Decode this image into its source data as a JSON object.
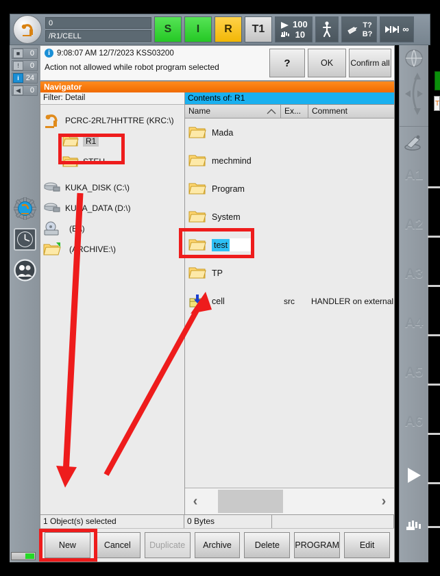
{
  "status_bar": {
    "program_number": "0",
    "program_path": "/R1/CELL",
    "submit_state": "S",
    "drives_state": "I",
    "robot_state": "R",
    "mode": "T1",
    "program_override": "100",
    "jog_override": "10",
    "increment_label": "∞",
    "tool_label": "T?",
    "base_label": "B?"
  },
  "message_counters": [
    {
      "icon": "ack-message-icon",
      "count": "0"
    },
    {
      "icon": "warning-message-icon",
      "count": "0"
    },
    {
      "icon": "info-message-icon",
      "count": "24"
    },
    {
      "icon": "wait-message-icon",
      "count": "0"
    }
  ],
  "message": {
    "timestamp": "9:08:07 AM 12/7/2023 KSS03200",
    "text": "Action not allowed while robot program selected",
    "help_label": "?",
    "ok_label": "OK",
    "confirm_all_label": "Confirm all"
  },
  "navigator": {
    "title": "Navigator",
    "filter_label": "Filter: Detail",
    "tree": [
      {
        "name": "PCRC-2RL7HHTTRE (KRC:\\)",
        "icon": "robot-icon",
        "level": 0,
        "selected": false
      },
      {
        "name": "R1",
        "icon": "folder-icon",
        "level": 1,
        "selected": true
      },
      {
        "name": "STEU",
        "icon": "folder-icon",
        "level": 1,
        "selected": false
      },
      {
        "name": "KUKA_DISK (C:\\)",
        "icon": "harddisk-icon",
        "level": 0,
        "selected": false
      },
      {
        "name": "KUKA_DATA (D:\\)",
        "icon": "harddisk-icon",
        "level": 0,
        "selected": false
      },
      {
        "name": "(E:\\)",
        "icon": "cddrive-icon",
        "level": 0,
        "selected": false
      },
      {
        "name": "(ARCHIVE:\\)",
        "icon": "archive-folder-icon",
        "level": 0,
        "selected": false
      }
    ],
    "contents_title": "Contents of: R1",
    "columns": [
      "Name",
      "Ex...",
      "Comment"
    ],
    "rows": [
      {
        "name": "Mada",
        "icon": "folder-icon",
        "ext": "",
        "comment": "",
        "editing": false
      },
      {
        "name": "mechmind",
        "icon": "folder-icon",
        "ext": "",
        "comment": "",
        "editing": false
      },
      {
        "name": "Program",
        "icon": "folder-icon",
        "ext": "",
        "comment": "",
        "editing": false
      },
      {
        "name": "System",
        "icon": "folder-icon",
        "ext": "",
        "comment": "",
        "editing": false
      },
      {
        "name": "test",
        "icon": "folder-icon",
        "ext": "",
        "comment": "",
        "editing": true
      },
      {
        "name": "TP",
        "icon": "folder-icon",
        "ext": "",
        "comment": "",
        "editing": false
      },
      {
        "name": "cell",
        "icon": "module-icon",
        "ext": "src",
        "comment": "HANDLER on external .",
        "editing": false
      }
    ],
    "scroll_left_label": "‹",
    "scroll_right_label": "›",
    "status_selected": "1 Object(s) selected",
    "status_bytes": "0 Bytes",
    "status_extra": "",
    "buttons": [
      {
        "label": "New",
        "enabled": true,
        "highlighted": true
      },
      {
        "label": "Cancel",
        "enabled": true,
        "highlighted": false
      },
      {
        "label": "Duplicate",
        "enabled": false,
        "highlighted": false
      },
      {
        "label": "Archive",
        "enabled": true,
        "highlighted": false
      },
      {
        "label": "Delete",
        "enabled": true,
        "highlighted": false
      },
      {
        "label": "PROGRAM",
        "enabled": true,
        "highlighted": false
      },
      {
        "label": "Edit",
        "enabled": true,
        "highlighted": false
      }
    ]
  },
  "jog_strip": {
    "axes": [
      "A1",
      "A2",
      "A3",
      "A4",
      "A5",
      "A6"
    ],
    "world_icon": "globe-icon",
    "motion_icon": "jog-arrows-icon",
    "tool_icon": "tool-jog-icon",
    "play_icon": "play-triangle-icon",
    "hand_icon": "hand-icon"
  },
  "edge": {
    "tab_label": "T"
  },
  "annotations": {
    "accent_color": "#ee1c1c",
    "highlight_boxes": [
      "tree-item-R1",
      "list-item-test",
      "button-New"
    ],
    "arrows": [
      "arrow-to-New-button",
      "arrow-to-test-folder"
    ]
  }
}
